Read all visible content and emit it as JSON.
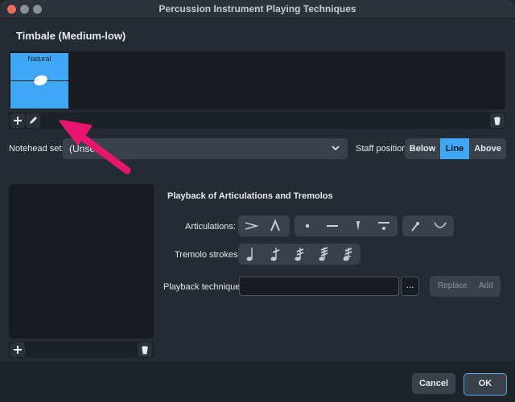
{
  "window": {
    "title": "Percussion Instrument Playing Techniques"
  },
  "instrument": {
    "name": "Timbale (Medium-low)"
  },
  "techniques": [
    {
      "label": "Natural",
      "selected": true
    }
  ],
  "notehead": {
    "label": "Notehead set:",
    "value": "(Unse"
  },
  "staff_position": {
    "label": "Staff position:",
    "options": [
      "Below",
      "Line",
      "Above"
    ],
    "selected": "Line"
  },
  "playback": {
    "section_title": "Playback of Articulations and Tremolos",
    "articulations_label": "Articulations:",
    "tremolo_label": "Tremolo strokes:",
    "technique_label": "Playback technique:",
    "technique_value": "",
    "browse_label": "...",
    "replace_label": "Replace",
    "add_label": "Add"
  },
  "footer": {
    "cancel_label": "Cancel",
    "ok_label": "OK"
  },
  "colors": {
    "accent": "#3fa7f5",
    "annotation_arrow": "#e8156f"
  }
}
